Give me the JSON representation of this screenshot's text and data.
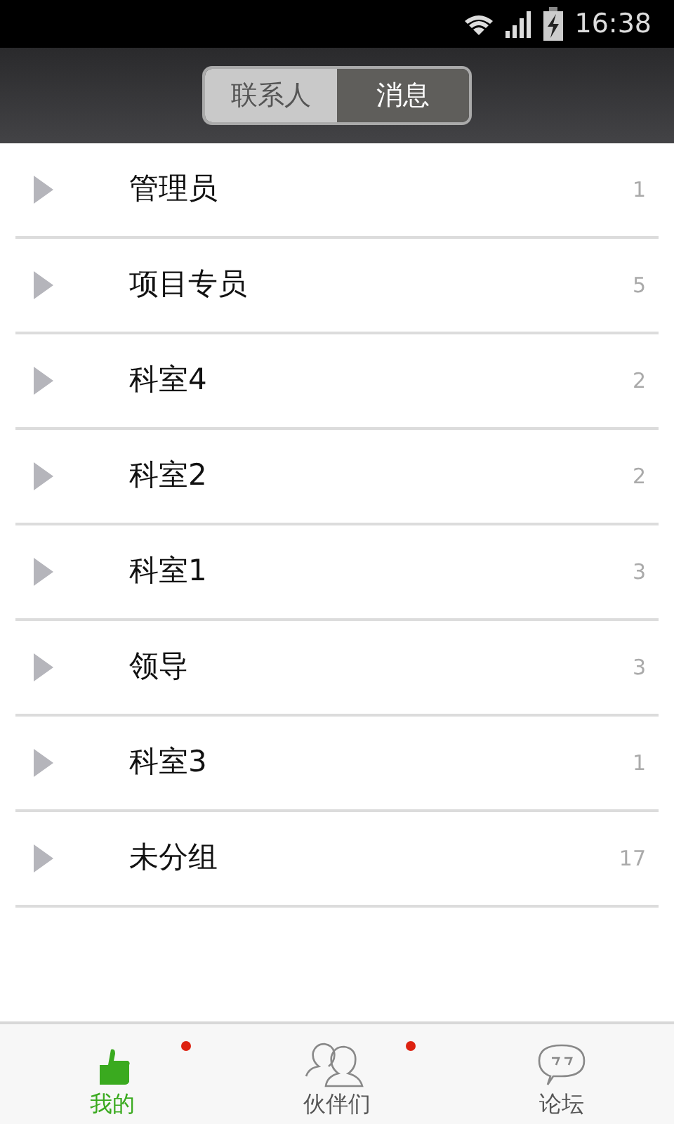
{
  "status_bar": {
    "time": "16:38"
  },
  "segments": [
    {
      "label": "联系人",
      "selected": false
    },
    {
      "label": "消息",
      "selected": true
    }
  ],
  "groups": [
    {
      "name": "管理员",
      "count": "1",
      "expanded": false
    },
    {
      "name": "项目专员",
      "count": "5",
      "expanded": false
    },
    {
      "name": "科室4",
      "count": "2",
      "expanded": false
    },
    {
      "name": "科室2",
      "count": "2",
      "expanded": false
    },
    {
      "name": "科室1",
      "count": "3",
      "expanded": false
    },
    {
      "name": "领导",
      "count": "3",
      "expanded": false
    },
    {
      "name": "科室3",
      "count": "1",
      "expanded": false
    },
    {
      "name": "未分组",
      "count": "17",
      "expanded": false
    }
  ],
  "bottom_tabs": [
    {
      "label": "我的",
      "kind": "thumb",
      "selected": true,
      "dot": true
    },
    {
      "label": "伙伴们",
      "kind": "people",
      "selected": false,
      "dot": true
    },
    {
      "label": "论坛",
      "kind": "chat",
      "selected": false,
      "dot": false
    }
  ]
}
